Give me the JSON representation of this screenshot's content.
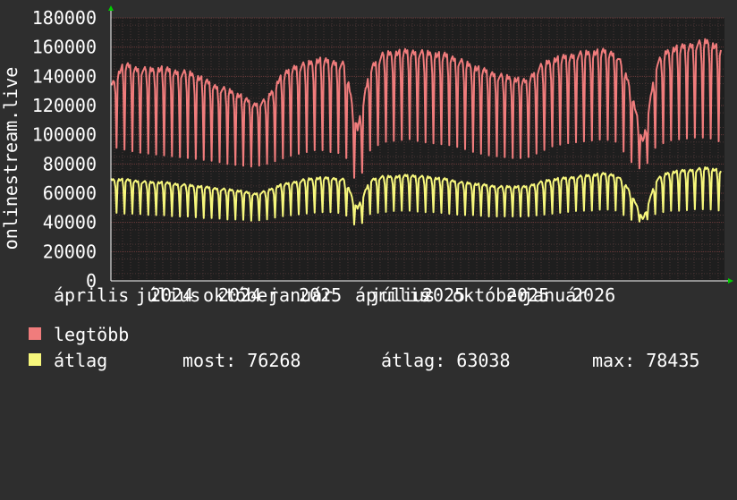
{
  "chart_data": {
    "type": "line",
    "ylabel": "onlinestream.live",
    "ylim": [
      0,
      180000
    ],
    "y_ticks": [
      0,
      20000,
      40000,
      60000,
      80000,
      100000,
      120000,
      140000,
      160000,
      180000
    ],
    "x_tick_labels": [
      "április",
      "július",
      "2024",
      "október",
      "2024",
      "január",
      "2025",
      "április",
      "július",
      "2025",
      "október",
      "2025",
      "január",
      "2026"
    ],
    "series": [
      {
        "name": "legtöbb",
        "color": "#f07c7c",
        "level_values": [
          135000,
          150000,
          147000,
          146000,
          147000,
          145000,
          144000,
          140000,
          135000,
          132000,
          128000,
          122000,
          125000,
          140000,
          148000,
          150000,
          153000,
          152000,
          150000,
          105000,
          148000,
          157000,
          158000,
          159000,
          158000,
          157000,
          156000,
          152000,
          148000,
          145000,
          142000,
          140000,
          138000,
          148000,
          153000,
          155000,
          157000,
          158000,
          159000,
          157000,
          135000,
          95000,
          150000,
          160000,
          162000,
          164000,
          166000,
          160000
        ],
        "dip_values": [
          92000,
          90000,
          88000,
          87000,
          86000,
          85000,
          84000,
          83000,
          82000,
          80000,
          79000,
          78000,
          80000,
          83000,
          86000,
          88000,
          90000,
          88000,
          87000,
          65000,
          90000,
          95000,
          96000,
          97000,
          95000,
          94000,
          93000,
          91000,
          88000,
          86000,
          85000,
          84000,
          84000,
          88000,
          92000,
          94000,
          95000,
          96000,
          97000,
          95000,
          82000,
          75000,
          92000,
          96000,
          97000,
          98000,
          98000,
          95000
        ]
      },
      {
        "name": "átlag",
        "color": "#f7f77c",
        "level_values": [
          70000,
          70000,
          69000,
          68000,
          68000,
          67000,
          66000,
          65000,
          64000,
          63000,
          62000,
          60000,
          62000,
          66000,
          68000,
          70000,
          71000,
          71000,
          70000,
          50000,
          70000,
          72000,
          72000,
          73000,
          72000,
          71000,
          70000,
          68000,
          67000,
          66000,
          65000,
          65000,
          65000,
          68000,
          70000,
          71000,
          72000,
          73000,
          74000,
          73000,
          62000,
          42000,
          70000,
          75000,
          76000,
          77000,
          78000,
          76000
        ],
        "dip_values": [
          47000,
          46000,
          46000,
          45000,
          45000,
          44000,
          44000,
          43000,
          43000,
          42000,
          42000,
          41000,
          42000,
          44000,
          45000,
          46000,
          47000,
          47000,
          46000,
          36000,
          46000,
          47000,
          48000,
          48000,
          47000,
          47000,
          46000,
          45000,
          45000,
          44000,
          44000,
          44000,
          44000,
          45000,
          46000,
          47000,
          48000,
          48000,
          49000,
          48000,
          42000,
          40000,
          46000,
          48000,
          48000,
          49000,
          49000,
          48000
        ]
      }
    ],
    "grid": true
  },
  "legend": {
    "items": [
      {
        "label": "legtöbb",
        "color": "#f07c7c"
      },
      {
        "label": "átlag",
        "color": "#f7f77c"
      }
    ],
    "stats": {
      "now": "most: 76268",
      "avg": "átlag: 63038",
      "max": "max: 78435"
    }
  },
  "colors": {
    "background": "#2e2e2e",
    "plot_background": "#1e1e1e",
    "grid_minor": "#4a3535",
    "grid_major": "#6a3a3a",
    "text": "#ffffff",
    "arrow": "#00cc00"
  }
}
